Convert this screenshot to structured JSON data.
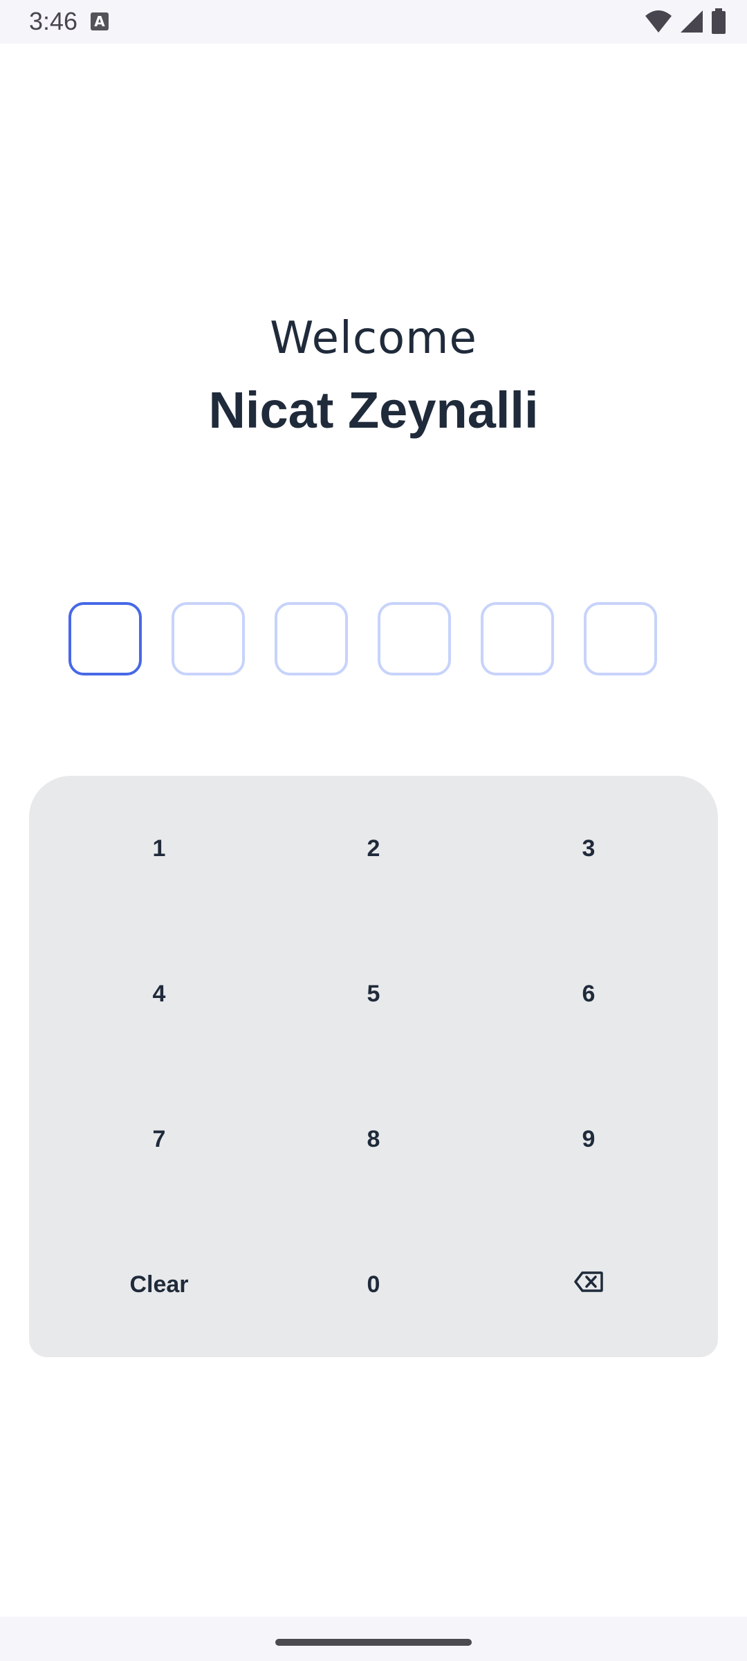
{
  "status_bar": {
    "time": "3:46",
    "notification_icon": "A",
    "icons": [
      "wifi-icon",
      "signal-icon",
      "battery-icon"
    ]
  },
  "greeting": {
    "welcome": "Welcome",
    "name": "Nicat Zeynalli"
  },
  "pin": {
    "length": 6,
    "filled": 0,
    "active_index": 0,
    "colors": {
      "active": "#4769e6",
      "inactive": "#c7d3fb"
    }
  },
  "keypad": {
    "keys": [
      {
        "label": "1",
        "name": "key-1"
      },
      {
        "label": "2",
        "name": "key-2"
      },
      {
        "label": "3",
        "name": "key-3"
      },
      {
        "label": "4",
        "name": "key-4"
      },
      {
        "label": "5",
        "name": "key-5"
      },
      {
        "label": "6",
        "name": "key-6"
      },
      {
        "label": "7",
        "name": "key-7"
      },
      {
        "label": "8",
        "name": "key-8"
      },
      {
        "label": "9",
        "name": "key-9"
      },
      {
        "label": "Clear",
        "name": "key-clear"
      },
      {
        "label": "0",
        "name": "key-0"
      },
      {
        "label": "",
        "name": "backspace-icon",
        "icon": "backspace-icon"
      }
    ],
    "background": "#e8e9eb"
  },
  "colors": {
    "text_primary": "#1f2a3a",
    "status_bar_bg": "#f6f6fa"
  }
}
